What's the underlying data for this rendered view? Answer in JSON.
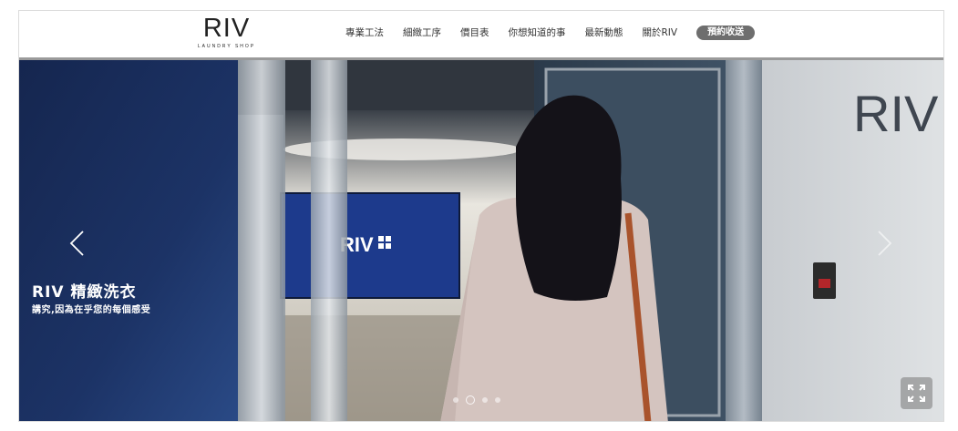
{
  "logo": {
    "main": "RIV",
    "sub": "LAUNDRY SHOP"
  },
  "nav": {
    "items": [
      "專業工法",
      "細緻工序",
      "價目表",
      "你想知道的事",
      "最新動態",
      "關於RIV"
    ],
    "cta": "預約收送"
  },
  "hero": {
    "title": "RIV 精緻洗衣",
    "subtitle": "講究,因為在乎您的每個感受",
    "wall_sign": "RIV",
    "screen_logo": "RIV",
    "prev_icon": "chevron-left-icon",
    "next_icon": "chevron-right-icon",
    "slide_count": 4,
    "active_slide": 2,
    "fullscreen_icon": "expand-icon"
  },
  "colors": {
    "cta_bg": "#6e6e6e",
    "header_border": "#9a9a9a",
    "screen_blue": "#1d3a8c"
  }
}
